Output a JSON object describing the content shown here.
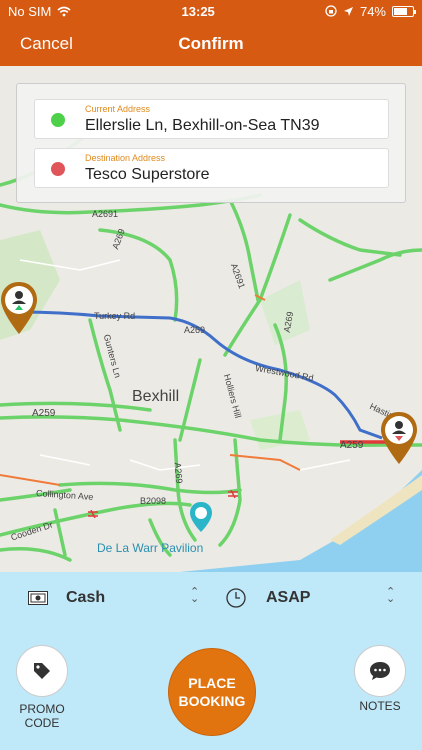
{
  "status_bar": {
    "carrier": "No SIM",
    "time": "13:25",
    "battery": "74%",
    "battery_level": 0.74
  },
  "nav": {
    "cancel_label": "Cancel",
    "title": "Confirm"
  },
  "addresses": {
    "current": {
      "caption": "Current Address",
      "value": "Ellerslie Ln, Bexhill-on-Sea TN39",
      "color": "#4fd04a"
    },
    "destination": {
      "caption": "Destination Address",
      "value": "Tesco Superstore",
      "color": "#e0555a"
    }
  },
  "map": {
    "town": "Bexhill",
    "poi": "De La Warr Pavilion",
    "roads": {
      "a2691": "A2691",
      "a269_north": "A269",
      "a2691_right": "A2691",
      "a269_mid": "A269",
      "a269_east": "A269",
      "turkey_rd": "Turkey Rd",
      "wrestwood_rd": "Wrestwood Rd",
      "gunters_ln": "Gunters Ln",
      "holliers_hill": "Holliers Hill",
      "hastings_rd": "Hastings Rd",
      "a259_west": "A259",
      "a259_east": "A259",
      "a269_south": "A269",
      "collington_ave": "Collington Ave",
      "b2098": "B2098",
      "cooden_dr": "Cooden Dr"
    },
    "route_color": "#3f6fc9",
    "pickup_marker_color": "#b06a12",
    "dropoff_marker_color": "#b06a12"
  },
  "options": {
    "payment": {
      "label": "Cash",
      "icon": "cash-icon"
    },
    "time": {
      "label": "ASAP",
      "icon": "clock-icon"
    }
  },
  "actions": {
    "promo_line1": "PROMO",
    "promo_line2": "CODE",
    "place_line1": "PLACE",
    "place_line2": "BOOKING",
    "notes_label": "NOTES"
  }
}
